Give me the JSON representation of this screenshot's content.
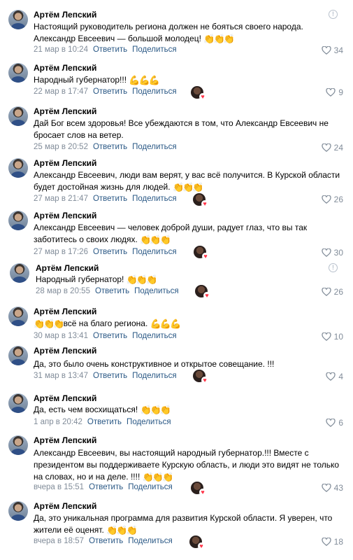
{
  "author_name": "Артём Лепский",
  "reply_label": "Ответить",
  "share_label": "Поделиться",
  "icons": {
    "like": "heart-outline-icon",
    "report": "exclamation-circle-icon",
    "liked_by": "user-avatar-with-heart"
  },
  "colors": {
    "link": "#2a5885",
    "meta": "#818c99",
    "heart": "#ff3347"
  },
  "comments": [
    {
      "text": "Настоящий руководитель региона должен не бояться своего народа. Александр Евсеевич — большой молодец!",
      "emoji": "👏👏👏",
      "date": "21 мар в 10:24",
      "likes": "34"
    },
    {
      "text": "Народный губернатор!!!",
      "emoji": "💪💪💪",
      "date": "22 мар в 17:47",
      "likes": "9"
    },
    {
      "text": "Дай Бог всем здоровья! Все убеждаются в том, что Александр Евсеевич не бросает слов на ветер.",
      "emoji": "",
      "date": "25 мар в 20:52",
      "likes": "24"
    },
    {
      "text": "Александр Евсеевич, люди вам верят, у вас всё получится. В Курской области будет достойная жизнь для людей.",
      "emoji": "👏👏👏",
      "date": "27 мар в 21:47",
      "likes": "26"
    },
    {
      "text": "Александр Евсеевич — человек доброй души, радует глаз, что вы так заботитесь о своих людях.",
      "emoji": "👏👏👏",
      "date": "27 мар в 17:26",
      "likes": "30"
    },
    {
      "text": "Народный губернатор!",
      "emoji": "👏👏👏",
      "date": "28 мар в 20:55",
      "likes": "26"
    },
    {
      "text_pre": "👏👏👏",
      "text": "всё на благо региона.",
      "emoji": "💪💪💪",
      "date": "30 мар в 13:41",
      "likes": "10"
    },
    {
      "text": "Да, это было очень конструктивное и открытое совещание. !!!",
      "emoji": "",
      "date": "31 мар в 13:47",
      "likes": "4"
    },
    {
      "text": "Да, есть чем восхищаться!",
      "emoji": "👏👏👏",
      "date": "1 апр в 20:42",
      "likes": "6"
    },
    {
      "text": "Александр Евсеевич, вы настоящий народный губернатор.!!! Вместе с президентом вы поддерживаете Курскую область, и люди это видят не только на словах, но и на деле. !!!!",
      "emoji": "👏👏👏",
      "date": "вчера в 15:51",
      "likes": "43"
    },
    {
      "text": "Да, это уникальная программа для развития Курской области. Я уверен, что жители её оценят.",
      "emoji": "👏👏👏",
      "date": "вчера в 18:57",
      "likes": "18"
    }
  ]
}
